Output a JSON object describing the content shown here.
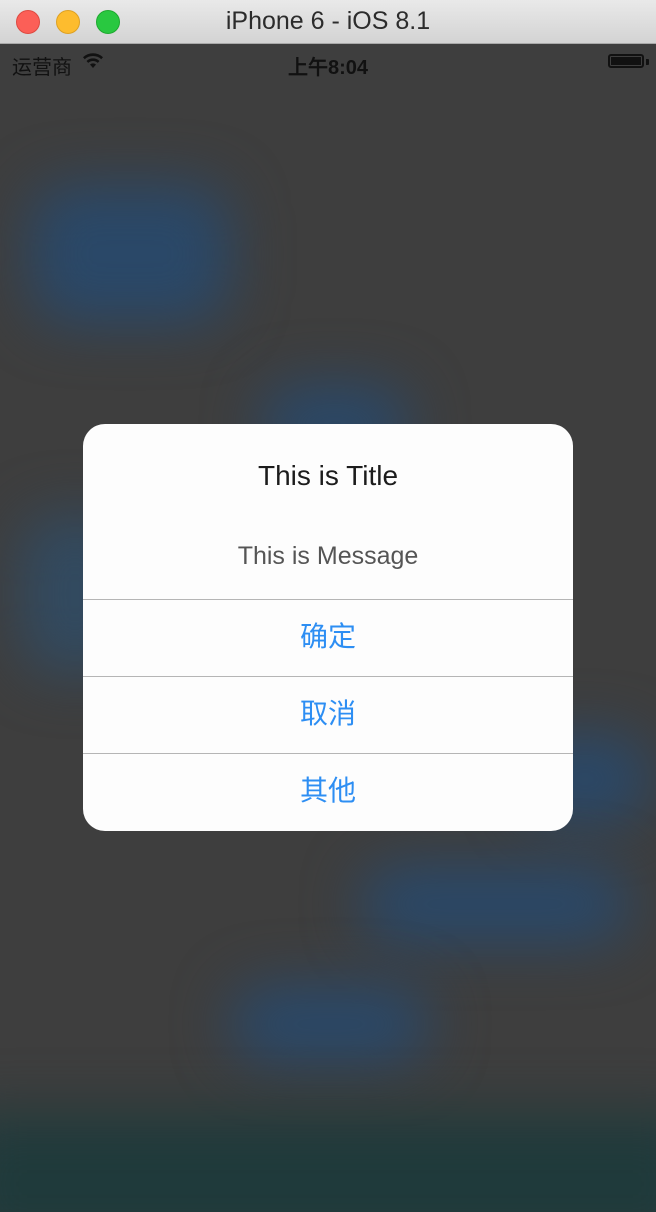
{
  "window": {
    "title": "iPhone 6 - iOS 8.1"
  },
  "status_bar": {
    "carrier": "运营商",
    "time": "上午8:04",
    "wifi_icon": "wifi-icon",
    "battery_icon": "battery-icon"
  },
  "alert": {
    "title": "This is Title",
    "message": "This is Message",
    "buttons": [
      {
        "label": "确定"
      },
      {
        "label": "取消"
      },
      {
        "label": "其他"
      }
    ]
  },
  "colors": {
    "button_text": "#2d8ef3",
    "backdrop": "#3e3e3e",
    "alert_background": "#fdfdfd"
  }
}
